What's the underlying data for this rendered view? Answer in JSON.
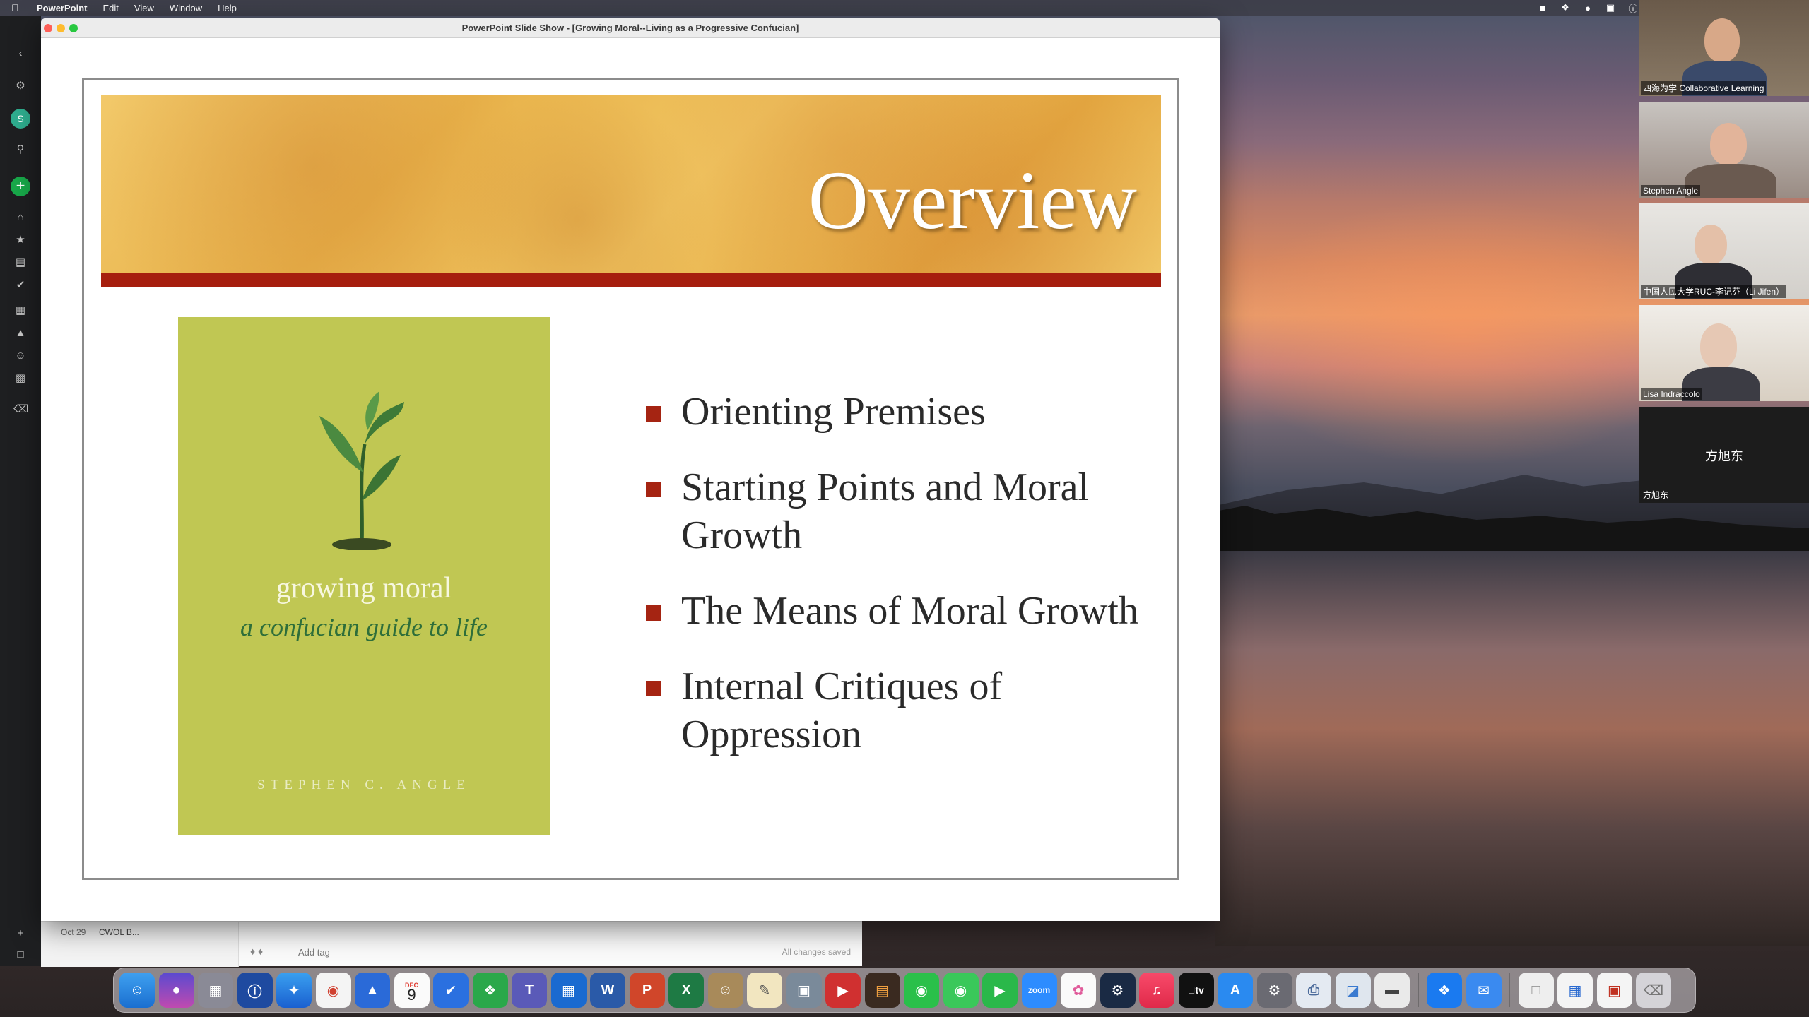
{
  "menubar": {
    "app_name": "PowerPoint",
    "menus": [
      "Edit",
      "View",
      "Window",
      "Help"
    ]
  },
  "window": {
    "title": "PowerPoint Slide Show - [Growing Moral--Living as a Progressive Confucian]"
  },
  "slide": {
    "title": "Overview",
    "bullets": [
      "Orienting Premises",
      "Starting Points and Moral Growth",
      "The Means of Moral Growth",
      "Internal Critiques of Oppression"
    ],
    "book": {
      "title": "growing moral",
      "subtitle": "a confucian guide to life",
      "author": "STEPHEN C. ANGLE"
    }
  },
  "notes_app": {
    "note_date": "Oct 29",
    "note_title": "CWOL B...",
    "add_tag": "Add tag",
    "save_status": "All changes saved"
  },
  "participants": [
    {
      "name": "四海为学 Collaborative Learning"
    },
    {
      "name": "Stephen Angle"
    },
    {
      "name": "中国人民大学RUC-李记芬（Li Jifen）"
    },
    {
      "name": "Lisa Indraccolo"
    },
    {
      "name": "方旭东",
      "display_label": "方旭东"
    }
  ],
  "dock": {
    "calendar_month": "DEC",
    "calendar_day": "9",
    "zoom_label": "zoom",
    "tv_label": "tv"
  },
  "colors": {
    "bullet": "#a52412",
    "banner_bar": "#a61e0e",
    "book_cover": "#c0c753"
  }
}
